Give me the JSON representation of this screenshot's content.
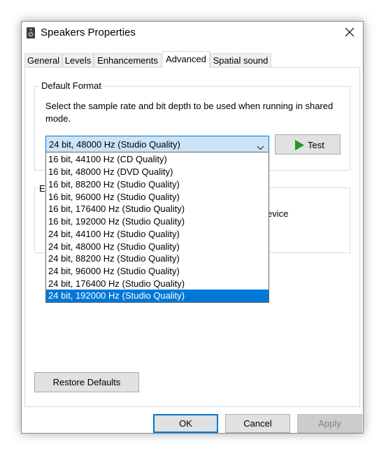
{
  "window": {
    "title": "Speakers Properties",
    "icon": "speaker-icon",
    "close_icon": "close-icon"
  },
  "tabs": [
    {
      "label": "General",
      "active": false
    },
    {
      "label": "Levels",
      "active": false
    },
    {
      "label": "Enhancements",
      "active": false
    },
    {
      "label": "Advanced",
      "active": true
    },
    {
      "label": "Spatial sound",
      "active": false
    }
  ],
  "default_format": {
    "group_title": "Default Format",
    "description": "Select the sample rate and bit depth to be used when running in shared mode.",
    "combo_value": "24 bit, 48000 Hz (Studio Quality)",
    "test_label": "Test",
    "test_icon": "play-icon",
    "options": [
      "16 bit, 44100 Hz (CD Quality)",
      "16 bit, 48000 Hz (DVD Quality)",
      "16 bit, 88200 Hz (Studio Quality)",
      "16 bit, 96000 Hz (Studio Quality)",
      "16 bit, 176400 Hz (Studio Quality)",
      "16 bit, 192000 Hz (Studio Quality)",
      "24 bit, 44100 Hz (Studio Quality)",
      "24 bit, 48000 Hz (Studio Quality)",
      "24 bit, 88200 Hz (Studio Quality)",
      "24 bit, 96000 Hz (Studio Quality)",
      "24 bit, 176400 Hz (Studio Quality)",
      "24 bit, 192000 Hz (Studio Quality)"
    ],
    "highlighted_option": "24 bit, 192000 Hz (Studio Quality)"
  },
  "exclusive_mode": {
    "group_title_fragment": "Ex",
    "device_fragment": "evice"
  },
  "restore_defaults_label": "Restore Defaults",
  "footer": {
    "ok_label": "OK",
    "cancel_label": "Cancel",
    "apply_label": "Apply"
  },
  "colors": {
    "accent": "#0078d7",
    "combo_bg": "#cce4f7",
    "play_green": "#1e9c1e"
  }
}
